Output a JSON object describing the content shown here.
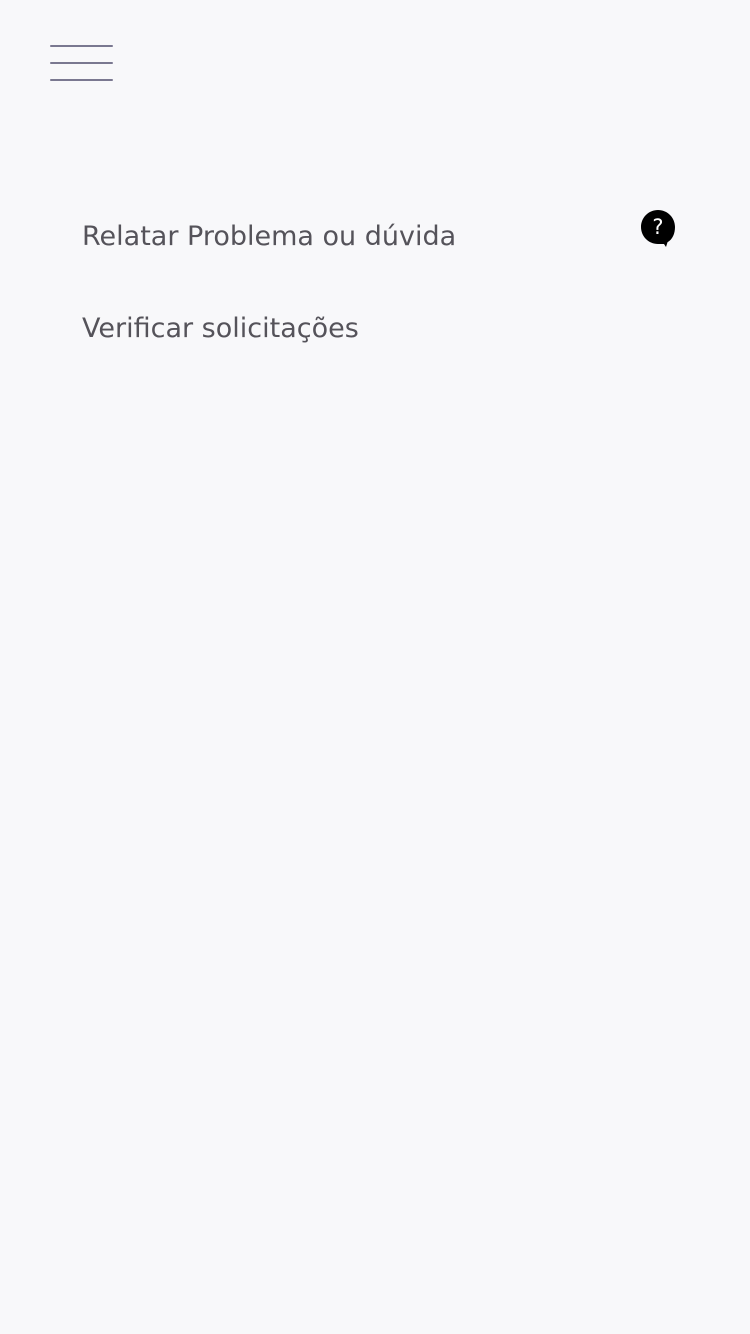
{
  "header": {
    "menu_icon": "hamburger-menu-icon"
  },
  "menu": {
    "items": [
      {
        "label": "Relatar Problema ou dúvida",
        "icon": "help-bubble-icon"
      },
      {
        "label": "Verificar solicitações"
      }
    ]
  },
  "colors": {
    "background": "#f8f8fa",
    "menu_icon": "#7a7890",
    "text": "#55535a",
    "help_icon": "#000000"
  }
}
